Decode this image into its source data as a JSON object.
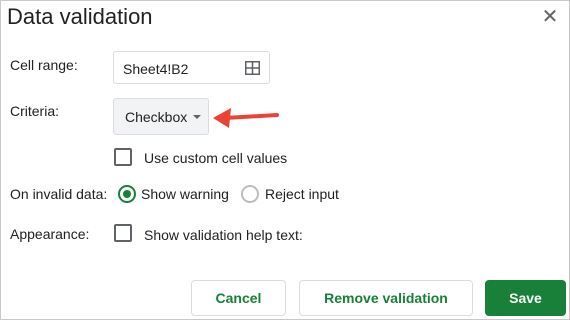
{
  "dialog": {
    "title": "Data validation",
    "close_icon": "close-icon"
  },
  "cell_range": {
    "label": "Cell range:",
    "value": "Sheet4!B2",
    "icon": "grid-select-icon"
  },
  "criteria": {
    "label": "Criteria:",
    "selected": "Checkbox",
    "icon": "chevron-down-icon",
    "annotation_arrow_color": "#ea4335"
  },
  "custom_values": {
    "label": "Use custom cell values",
    "checked": false
  },
  "invalid_data": {
    "label": "On invalid data:",
    "options": [
      {
        "label": "Show warning",
        "selected": true
      },
      {
        "label": "Reject input",
        "selected": false
      }
    ]
  },
  "appearance": {
    "label": "Appearance:",
    "help_text_label": "Show validation help text:",
    "checked": false
  },
  "buttons": {
    "cancel": "Cancel",
    "remove": "Remove validation",
    "save": "Save"
  },
  "colors": {
    "accent": "#188038",
    "arrow": "#ea4335"
  }
}
